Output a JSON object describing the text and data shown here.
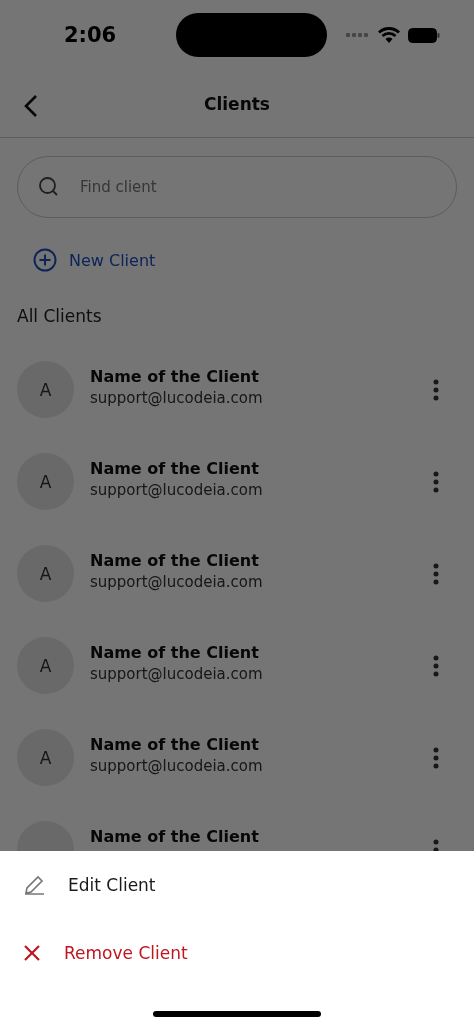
{
  "status_bar": {
    "time": "2:06"
  },
  "header": {
    "title": "Clients"
  },
  "search": {
    "placeholder": "Find client"
  },
  "new_client": {
    "label": "New Client"
  },
  "section_title": "All Clients",
  "clients": [
    {
      "initial": "A",
      "name": "Name of the Client",
      "email": "support@lucodeia.com"
    },
    {
      "initial": "A",
      "name": "Name of the Client",
      "email": "support@lucodeia.com"
    },
    {
      "initial": "A",
      "name": "Name of the Client",
      "email": "support@lucodeia.com"
    },
    {
      "initial": "A",
      "name": "Name of the Client",
      "email": "support@lucodeia.com"
    },
    {
      "initial": "A",
      "name": "Name of the Client",
      "email": "support@lucodeia.com"
    },
    {
      "name": "Name of the Client"
    }
  ],
  "action_sheet": {
    "actions": [
      {
        "kind": "edit",
        "label": "Edit Client"
      },
      {
        "kind": "remove",
        "label": "Remove Client"
      }
    ]
  }
}
